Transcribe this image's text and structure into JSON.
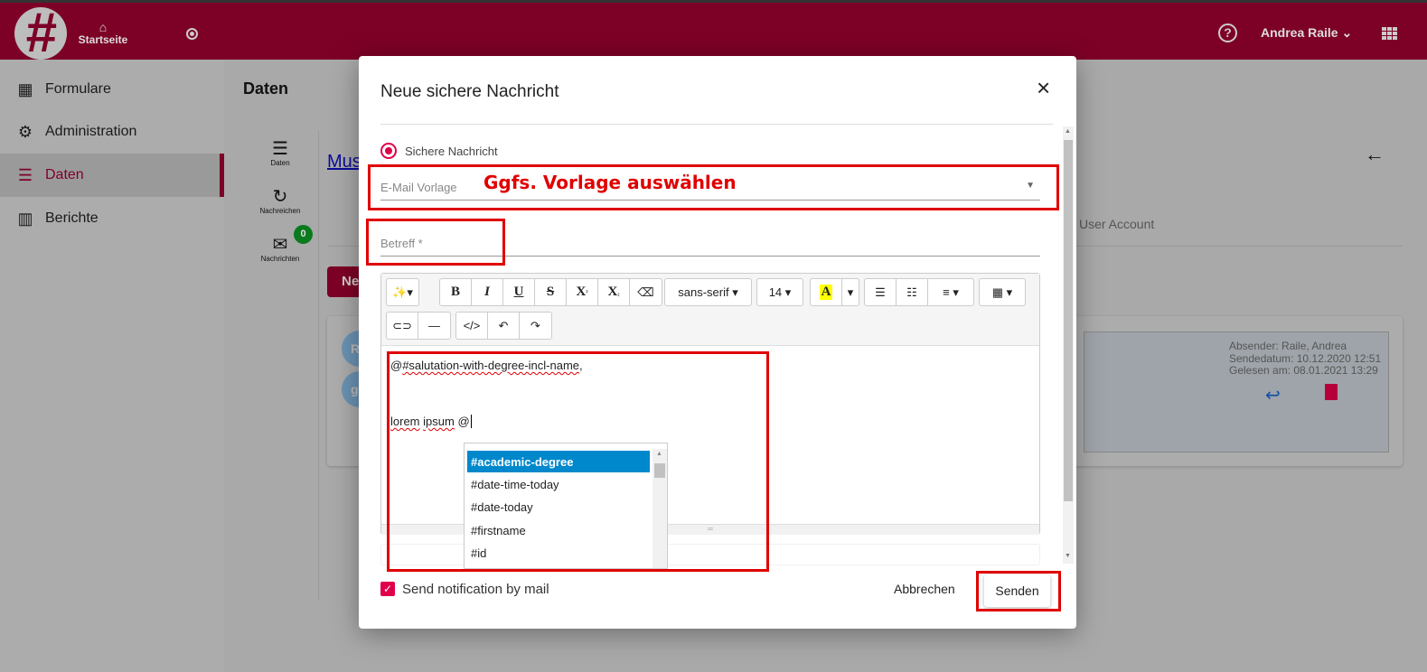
{
  "header": {
    "home_label": "Startseite",
    "user_name": "Andrea Raile",
    "help_icon": "help-circle-icon",
    "apps_icon": "grid-icon"
  },
  "sidebar": {
    "items": [
      {
        "label": "Formulare",
        "icon": "dashboard-icon"
      },
      {
        "label": "Administration",
        "icon": "gear-icon"
      },
      {
        "label": "Daten",
        "icon": "storage-icon",
        "active": true
      },
      {
        "label": "Berichte",
        "icon": "chart-icon"
      }
    ]
  },
  "main": {
    "title": "Daten",
    "mini_nav": [
      {
        "label": "Daten"
      },
      {
        "label": "Nachreichen"
      },
      {
        "label": "Nachrichten",
        "badge": "0"
      }
    ],
    "link_text": "Mus",
    "tab_user_account": "User Account",
    "new_button": "Ne",
    "avatars": [
      "R",
      "g"
    ],
    "message": {
      "sender": "Absender: Raile, Andrea",
      "sent": "Sendedatum: 10.12.2020 12:51",
      "read": "Gelesen am: 08.01.2021 13:29"
    }
  },
  "modal": {
    "title": "Neue sichere Nachricht",
    "radio_label": "Sichere Nachricht",
    "template_placeholder": "E-Mail Vorlage",
    "template_hint": "Ggfs. Vorlage auswählen",
    "subject_placeholder": "Betreff *",
    "toolbar": {
      "font_name": "sans-serif",
      "font_size": "14",
      "color_letter": "A",
      "highlight_color": "#ffff00"
    },
    "content": {
      "line1_at": "@",
      "line1_tag": "#salutation-with-degree-incl-name",
      "line1_end": ",",
      "line2_words": [
        "lorem",
        "ipsum"
      ],
      "line2_at": "@"
    },
    "suggestions": [
      "#academic-degree",
      "#date-time-today",
      "#date-today",
      "#firstname",
      "#id"
    ],
    "notify_label": "Send notification by mail",
    "notify_checked": true,
    "cancel_label": "Abbrechen",
    "send_label": "Senden"
  },
  "colors": {
    "brand": "#7d0027",
    "accent": "#e0004a",
    "annotation": "#e00000",
    "selection": "#0088cc"
  }
}
